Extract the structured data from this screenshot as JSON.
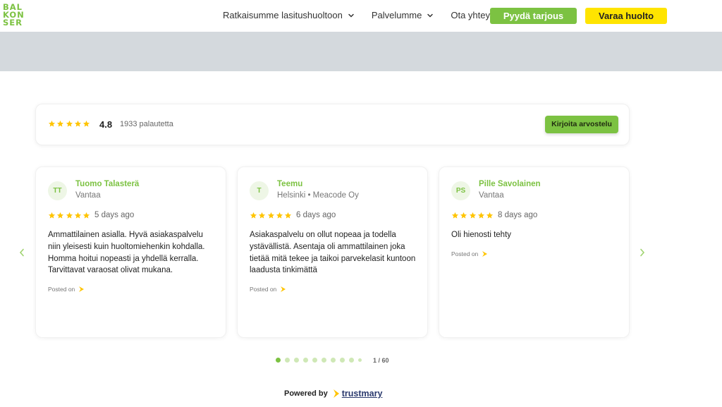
{
  "header": {
    "logo_lines": [
      "BAL",
      "KON",
      "SER"
    ],
    "nav": [
      {
        "label": "Ratkaisumme lasitushuoltoon",
        "has_dropdown": true
      },
      {
        "label": "Palvelumme",
        "has_dropdown": true
      },
      {
        "label": "Ota yhteyttä",
        "has_dropdown": false
      }
    ],
    "quote_button": "Pyydä tarjous",
    "service_button": "Varaa huolto"
  },
  "summary": {
    "stars": 5,
    "rating": "4.8",
    "count": "1933 palautetta",
    "write_review_button": "Kirjoita arvostelu"
  },
  "reviews": [
    {
      "initials": "TT",
      "name": "Tuomo Talasterä",
      "location": "Vantaa",
      "stars": 5,
      "ago": "5 days ago",
      "text": "Ammattilainen asialla. Hyvä asiakaspalvelu niin yleisesti kuin huoltomiehenkin kohdalla. Homma hoitui nopeasti ja yhdellä kerralla. Tarvittavat varaosat olivat mukana.",
      "posted_on": "Posted on"
    },
    {
      "initials": "T",
      "name": "Teemu",
      "location": "Helsinki • Meacode Oy",
      "stars": 5,
      "ago": "6 days ago",
      "text": "Asiakaspalvelu on ollut nopeaa ja todella ystävällistä. Asentaja oli ammattilainen joka tietää mitä tekee ja taikoi parvekelasit kuntoon laadusta tinkimättä",
      "posted_on": "Posted on"
    },
    {
      "initials": "PS",
      "name": "Pille Savolainen",
      "location": "Vantaa",
      "stars": 5,
      "ago": "8 days ago",
      "text": "Oli hienosti tehty",
      "posted_on": "Posted on"
    }
  ],
  "carousel": {
    "dot_count": 10,
    "active_index": 0,
    "pager": "1 / 60"
  },
  "footer": {
    "powered_by": "Powered by",
    "brand": "trustmary"
  },
  "colors": {
    "brand_green": "#7cc242",
    "brand_yellow": "#ffe400",
    "star": "#ffc400",
    "band_grey": "#d4d9dd"
  },
  "icons": [
    "star-icon",
    "chevron-down-icon",
    "chevron-left-icon",
    "chevron-right-icon",
    "trustmary-bird-icon"
  ]
}
